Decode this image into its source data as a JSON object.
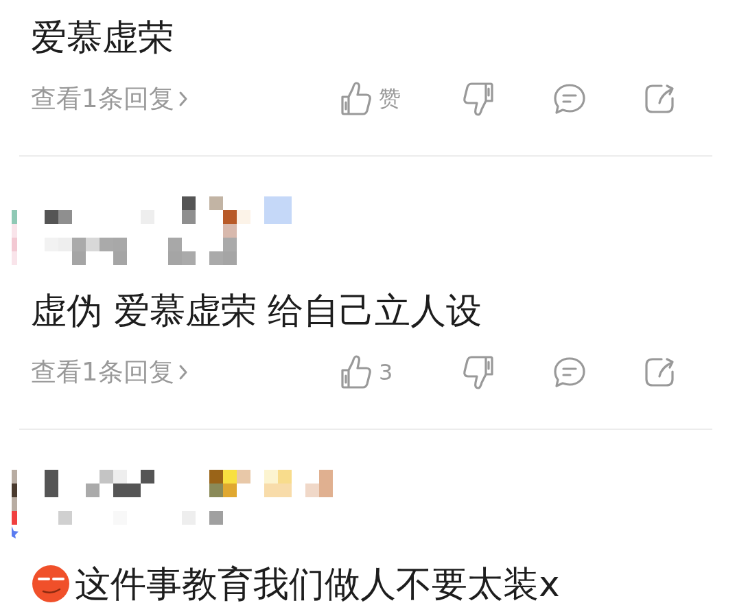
{
  "comments": [
    {
      "kind": "continued",
      "text": "爱慕虚荣",
      "replies_link": "查看1条回复",
      "like_label": "赞"
    },
    {
      "kind": "full",
      "text": "虚伪 爱慕虚荣 给自己立人设",
      "replies_link": "查看1条回复",
      "like_label": "3"
    },
    {
      "kind": "emoji",
      "text": "这件事教育我们做人不要太装x"
    }
  ]
}
